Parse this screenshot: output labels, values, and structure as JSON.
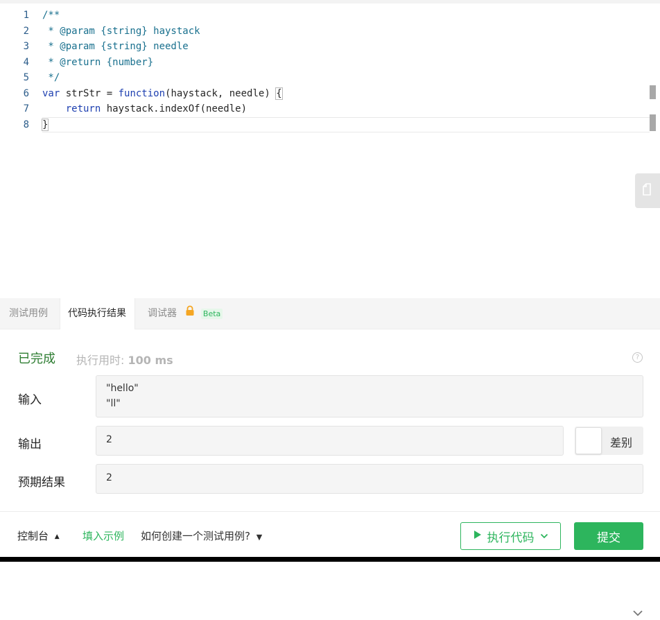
{
  "editor": {
    "lines": [
      {
        "num": "1",
        "parts": [
          {
            "cls": "cm",
            "text": "/**"
          }
        ]
      },
      {
        "num": "2",
        "parts": [
          {
            "cls": "cm",
            "text": " * @param {string} haystack"
          }
        ]
      },
      {
        "num": "3",
        "parts": [
          {
            "cls": "cm",
            "text": " * @param {string} needle"
          }
        ]
      },
      {
        "num": "4",
        "parts": [
          {
            "cls": "cm",
            "text": " * @return {number}"
          }
        ]
      },
      {
        "num": "5",
        "parts": [
          {
            "cls": "cm",
            "text": " */"
          }
        ]
      },
      {
        "num": "6",
        "parts": [
          {
            "cls": "kw",
            "text": "var"
          },
          {
            "cls": "",
            "text": " strStr = "
          },
          {
            "cls": "kw",
            "text": "function"
          },
          {
            "cls": "",
            "text": "(haystack, needle) "
          },
          {
            "cls": "brace-box",
            "text": "{"
          }
        ]
      },
      {
        "num": "7",
        "parts": [
          {
            "cls": "",
            "text": "    "
          },
          {
            "cls": "kw",
            "text": "return"
          },
          {
            "cls": "",
            "text": " haystack.indexOf(needle)"
          }
        ]
      },
      {
        "num": "8",
        "parts": [
          {
            "cls": "brace-box",
            "text": "}"
          }
        ]
      }
    ],
    "copy_icon": "copy-icon"
  },
  "tabs": {
    "testcase": "测试用例",
    "result": "代码执行结果",
    "debugger": "调试器",
    "beta": "Beta",
    "collapse_icon": "chevron-down-icon"
  },
  "result": {
    "status": "已完成",
    "time_label": "执行用时:",
    "time_value": "100 ms",
    "help": "?",
    "input_label": "输入",
    "input_lines": [
      "\"hello\"",
      "\"ll\""
    ],
    "output_label": "输出",
    "output_value": "2",
    "diff_label": "差别",
    "expected_label": "预期结果",
    "expected_value": "2"
  },
  "footer": {
    "console": "控制台",
    "fill_example": "填入示例",
    "how_to": "如何创建一个测试用例?",
    "run": "执行代码",
    "submit": "提交"
  },
  "colors": {
    "accent": "#2db55d",
    "status_green": "#2e7d32"
  }
}
